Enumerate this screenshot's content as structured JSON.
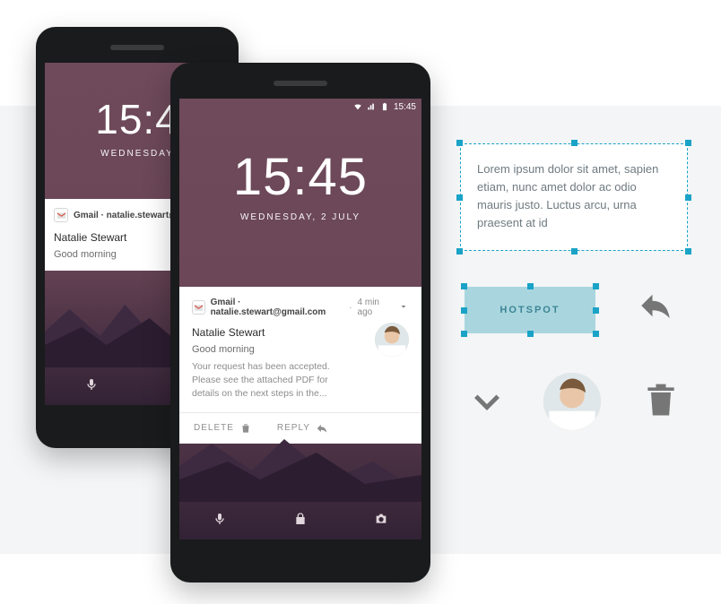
{
  "phone_small": {
    "time": "15:4",
    "date": "WEDNESDAY",
    "notif_title": "Gmail · natalie.stewart@g",
    "sender": "Natalie Stewart",
    "subject": "Good morning"
  },
  "phone_large": {
    "status_time": "15:45",
    "time": "15:45",
    "date": "WEDNESDAY, 2 JULY",
    "notif_title": "Gmail · natalie.stewart@gmail.com",
    "ago": "4 min ago",
    "sender": "Natalie Stewart",
    "subject": "Good morning",
    "body": "Your request has been accepted. Please see the attached PDF for details on the next steps in the...",
    "delete_label": "DELETE",
    "reply_label": "REPLY"
  },
  "palette": {
    "lorem": "Lorem ipsum dolor sit amet, sapien etiam, nunc amet dolor ac odio mauris justo. Luctus arcu, urna praesent at id",
    "hotspot_label": "HOTSPOT"
  }
}
